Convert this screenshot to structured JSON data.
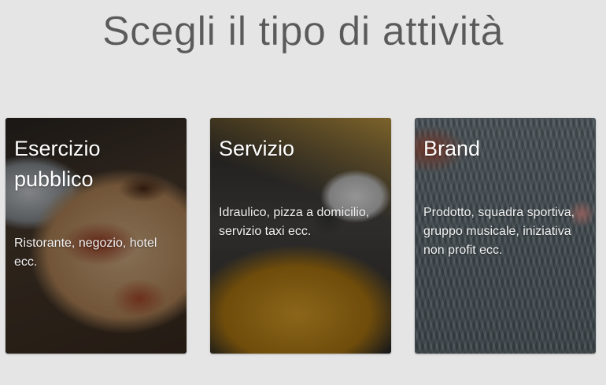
{
  "page": {
    "title": "Scegli il tipo di attività"
  },
  "cards": [
    {
      "title": "Esercizio pubblico",
      "description": "Ristorante, negozio, hotel ecc.",
      "image": "pizza-photo"
    },
    {
      "title": "Servizio",
      "description": "Idraulico, pizza a domicilio, servizio taxi ecc.",
      "image": "taxi-scooter-photo"
    },
    {
      "title": "Brand",
      "description": "Prodotto, squadra sportiva, gruppo musicale, iniziativa non profit ecc.",
      "image": "knit-sweater-photo"
    }
  ],
  "colors": {
    "background": "#e5e5e5",
    "title_text": "#5a5a5a",
    "card_text": "#ffffff"
  }
}
